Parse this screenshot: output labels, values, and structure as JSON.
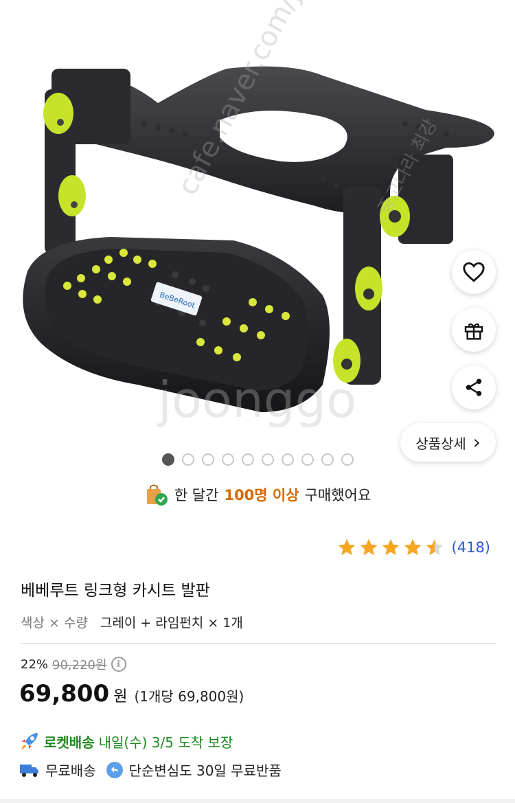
{
  "watermark": {
    "text1": "cafe.naver.com/joonggonara",
    "text2": "joonggo",
    "text3": "중고나라 최강"
  },
  "product_image": {
    "label": "BeBeRoot"
  },
  "actions": {
    "detail_label": "상품상세",
    "detail_chevron": "›"
  },
  "carousel": {
    "total": 10,
    "active_index": 0
  },
  "social_proof": {
    "prefix": "한 달간",
    "highlight": "100명 이상",
    "suffix": "구매했어요"
  },
  "rating": {
    "stars": 4.5,
    "count": "(418)"
  },
  "product": {
    "title": "베베루트 링크형 카시트 발판",
    "option_label": "색상 × 수량",
    "option_value": "그레이 + 라임펀치 × 1개"
  },
  "pricing": {
    "discount": "22%",
    "original": "90,220원",
    "info_icon": "i",
    "sale_number": "69,800",
    "sale_currency": "원",
    "unit_price": "(1개당 69,800원)"
  },
  "shipping": {
    "rocket_label": "로켓배송",
    "rocket_text": "내일(수) 3/5 도착 보장",
    "free_shipping": "무료배송",
    "free_return": "단순변심도 30일 무료반품"
  },
  "colors": {
    "lime": "#c6e32a",
    "accent_orange": "#d46a00",
    "rocket_green": "#1e8a1e",
    "star": "#f5a623",
    "count_blue": "#2b57d6"
  }
}
